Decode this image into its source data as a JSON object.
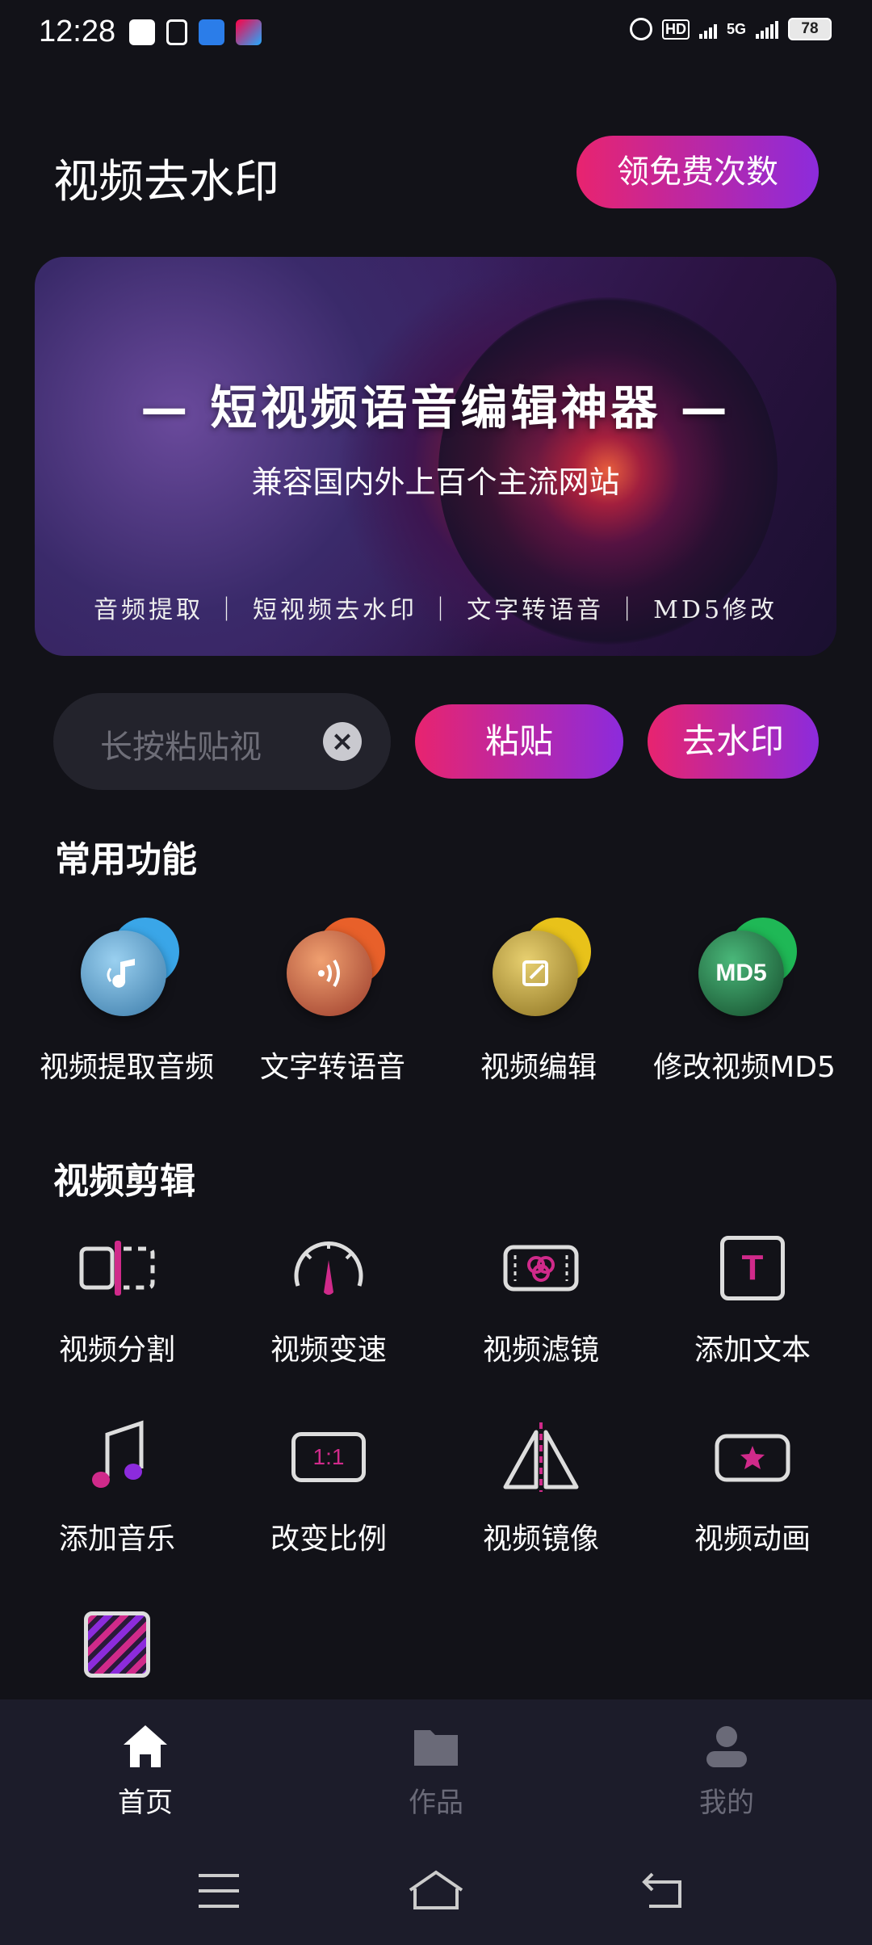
{
  "status_bar": {
    "time": "12:28",
    "network": "5G",
    "battery": "78",
    "hd_label": "HD"
  },
  "header": {
    "title": "视频去水印",
    "free_button": "领免费次数"
  },
  "banner": {
    "title": "— 短视频语音编辑神器 —",
    "subtitle": "兼容国内外上百个主流网站",
    "tags": "音频提取 ｜ 短视频去水印 ｜ 文字转语音 ｜ MD5修改"
  },
  "input_row": {
    "placeholder": "长按粘贴视",
    "paste_button": "粘贴",
    "remove_button": "去水印"
  },
  "common": {
    "title": "常用功能",
    "items": [
      {
        "label": "视频提取音频",
        "icon": "music-note-icon",
        "color": "#3aa6e8"
      },
      {
        "label": "文字转语音",
        "icon": "sound-wave-icon",
        "color": "#e8602a"
      },
      {
        "label": "视频编辑",
        "icon": "edit-icon",
        "color": "#e8c21a"
      },
      {
        "label": "修改视频MD5",
        "icon": "md5-icon",
        "color": "#1fb856",
        "icon_text": "MD5"
      }
    ]
  },
  "video_edit": {
    "title": "视频剪辑",
    "items": [
      {
        "label": "视频分割",
        "icon": "split-icon"
      },
      {
        "label": "视频变速",
        "icon": "speed-icon"
      },
      {
        "label": "视频滤镜",
        "icon": "filter-icon"
      },
      {
        "label": "添加文本",
        "icon": "text-icon",
        "icon_text": "T"
      },
      {
        "label": "添加音乐",
        "icon": "music-icon"
      },
      {
        "label": "改变比例",
        "icon": "ratio-icon",
        "icon_text": "1:1"
      },
      {
        "label": "视频镜像",
        "icon": "mirror-icon"
      },
      {
        "label": "视频动画",
        "icon": "animation-icon"
      },
      {
        "label": "",
        "icon": "background-icon"
      }
    ]
  },
  "nav": {
    "items": [
      {
        "label": "首页",
        "icon": "home-icon",
        "active": true
      },
      {
        "label": "作品",
        "icon": "folder-icon",
        "active": false
      },
      {
        "label": "我的",
        "icon": "user-icon",
        "active": false
      }
    ]
  },
  "colors": {
    "background": "#121218",
    "accent_start": "#e8246f",
    "accent_end": "#8c2bdc",
    "nav_bg": "#1c1c2a"
  }
}
